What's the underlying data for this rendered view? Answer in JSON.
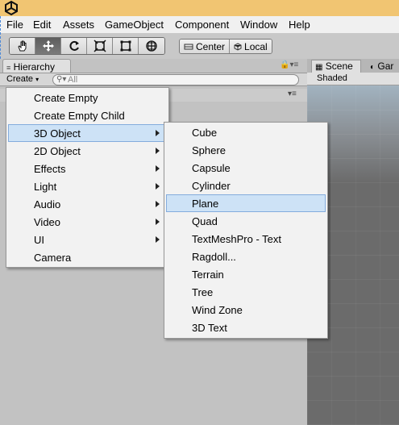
{
  "menubar": {
    "items": [
      "File",
      "Edit",
      "Assets",
      "GameObject",
      "Component",
      "Window",
      "Help"
    ]
  },
  "toolbar": {
    "tools": [
      "hand-tool-icon",
      "move-tool-icon",
      "rotate-tool-icon",
      "scale-tool-icon",
      "rect-tool-icon",
      "transform-tool-icon"
    ],
    "active_tool": "move-tool-icon",
    "pivot_label": "Center",
    "space_label": "Local"
  },
  "hierarchy": {
    "tab_label": "Hierarchy",
    "create_label": "Create",
    "search_placeholder": "All"
  },
  "scene": {
    "tab_label": "Scene",
    "game_tab_label": "Gar",
    "shading_mode": "Shaded"
  },
  "create_menu": {
    "items": [
      {
        "label": "Create Empty",
        "submenu": false
      },
      {
        "label": "Create Empty Child",
        "submenu": false
      },
      {
        "label": "3D Object",
        "submenu": true
      },
      {
        "label": "2D Object",
        "submenu": true
      },
      {
        "label": "Effects",
        "submenu": true
      },
      {
        "label": "Light",
        "submenu": true
      },
      {
        "label": "Audio",
        "submenu": true
      },
      {
        "label": "Video",
        "submenu": true
      },
      {
        "label": "UI",
        "submenu": true
      },
      {
        "label": "Camera",
        "submenu": false
      }
    ],
    "highlighted": "3D Object"
  },
  "object3d_menu": {
    "items": [
      "Cube",
      "Sphere",
      "Capsule",
      "Cylinder",
      "Plane",
      "Quad",
      "TextMeshPro - Text",
      "Ragdoll...",
      "Terrain",
      "Tree",
      "Wind Zone",
      "3D Text"
    ],
    "highlighted": "Plane"
  },
  "colors": {
    "title_bar": "#f1c572",
    "menu_highlight": "#cde2f6",
    "menu_highlight_border": "#84acdd"
  }
}
